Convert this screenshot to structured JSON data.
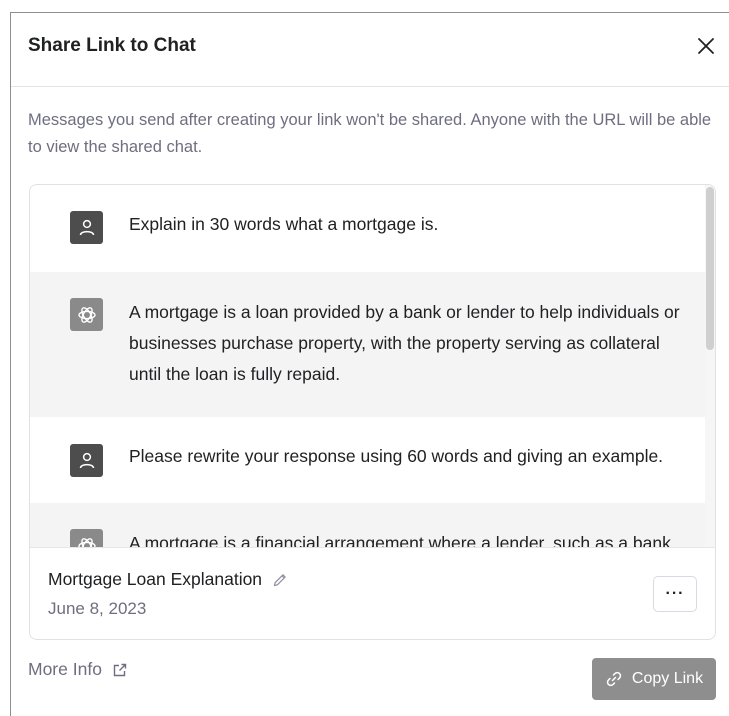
{
  "dialog": {
    "title": "Share Link to Chat",
    "description": "Messages you send after creating your link won't be shared. Anyone with the URL will be able to view the shared chat."
  },
  "messages": [
    {
      "role": "user",
      "text": "Explain in 30 words what a mortgage is."
    },
    {
      "role": "assistant",
      "text": "A mortgage is a loan provided by a bank or lender to help individuals or businesses purchase property, with the property serving as collateral until the loan is fully repaid."
    },
    {
      "role": "user",
      "text": "Please rewrite your response using 60 words and giving an example."
    },
    {
      "role": "assistant",
      "text": "A mortgage is a financial arrangement where a lender, such as a bank"
    }
  ],
  "footer": {
    "chat_title": "Mortgage Loan Explanation",
    "date": "June 8, 2023",
    "more_label": "···"
  },
  "actions": {
    "more_info_label": "More Info",
    "copy_link_label": "Copy Link"
  },
  "icons": {
    "close": "close-icon",
    "user_avatar": "user-icon",
    "assistant_avatar": "openai-logo-icon",
    "edit": "pencil-icon",
    "external": "external-link-icon",
    "link": "link-icon"
  },
  "colors": {
    "copy_button_bg": "#8e8e8e",
    "assistant_row_bg": "#f4f4f4",
    "muted_text": "#6e6e80"
  }
}
